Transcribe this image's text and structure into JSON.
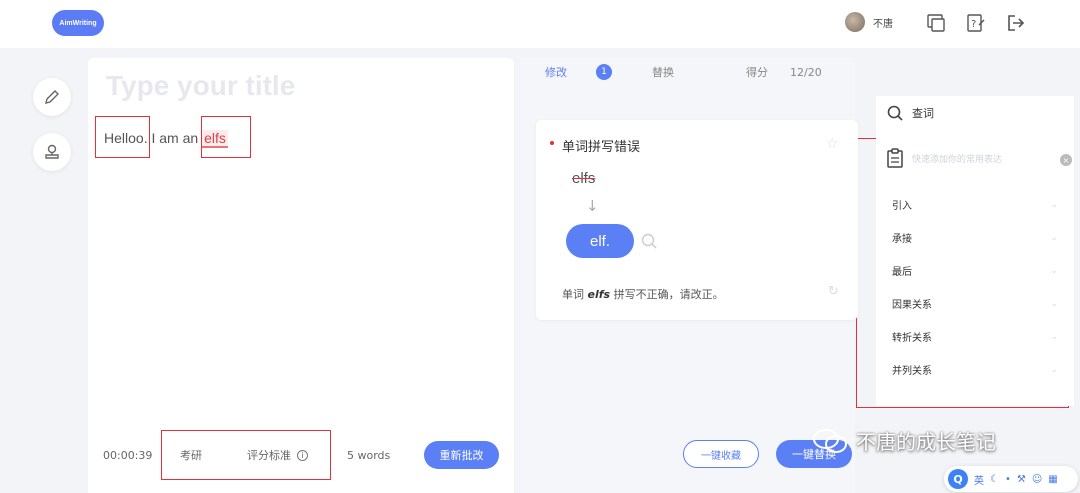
{
  "header": {
    "logo_text": "AimWriting",
    "username": "不唐"
  },
  "editor": {
    "title_placeholder": "Type your title",
    "text_before": "Helloo. I am an ",
    "error_word": "elfs"
  },
  "footer": {
    "timer": "00:00:39",
    "exam": "考研",
    "standard": "评分标准",
    "info": "i",
    "words": "5 words",
    "recorrect": "重新批改"
  },
  "mid": {
    "tab_modify": "修改",
    "badge": "1",
    "tab_replace": "替换",
    "score_label": "得分",
    "score_value": "12/20",
    "card_title": "单词拼写错误",
    "wrong_word": "elfs",
    "arrow": "↓",
    "fix_word": "elf.",
    "desc_prefix": "单词 ",
    "desc_word": "elfs",
    "desc_suffix": " 拼写不正确，请改正。",
    "collect_btn": "一键收藏",
    "replace_btn": "一键替换"
  },
  "right": {
    "query_label": "查词",
    "clip_placeholder": "快速添加你的常用表达",
    "items": [
      "引入",
      "承接",
      "最后",
      "因果关系",
      "转折关系",
      "并列关系"
    ]
  },
  "watermark": "不唐的成长笔记",
  "ime": {
    "logo": "Q",
    "lang": "英"
  },
  "colors": {
    "accent": "#5b80f5",
    "highlight_box": "#e0313c"
  }
}
